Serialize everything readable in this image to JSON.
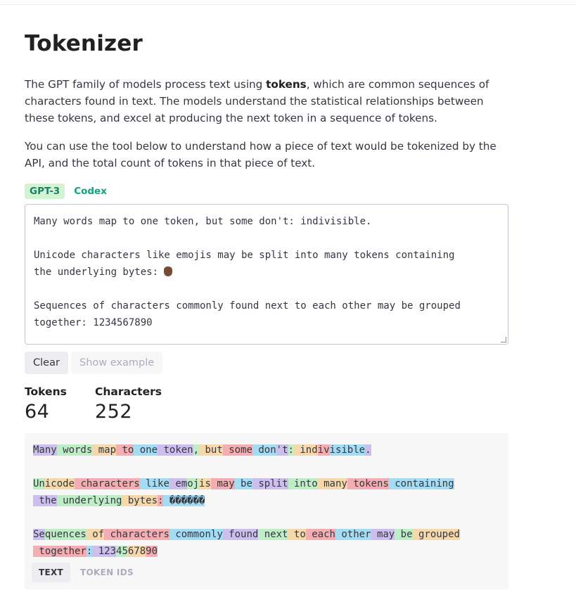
{
  "page": {
    "title": "Tokenizer",
    "intro_before": "The GPT family of models process text using ",
    "intro_bold": "tokens",
    "intro_after": ", which are common sequences of characters found in text. The models understand the statistical relationships between these tokens, and excel at producing the next token in a sequence of tokens.",
    "intro2": "You can use the tool below to understand how a piece of text would be tokenized by the API, and the total count of tokens in that piece of text."
  },
  "model_tabs": [
    {
      "label": "GPT-3",
      "active": true
    },
    {
      "label": "Codex",
      "active": false
    }
  ],
  "input": {
    "line1": "Many words map to one token, but some don't: indivisible.",
    "line2": "Unicode characters like emojis may be split into many tokens containing",
    "line3": "the underlying bytes: ",
    "emoji": "raised-hand-medium-dark-skin-tone",
    "line4": "Sequences of characters commonly found next to each other may be grouped",
    "line5": "together: 1234567890"
  },
  "buttons": {
    "clear": "Clear",
    "show_example": "Show example"
  },
  "stats": {
    "tokens_label": "Tokens",
    "tokens_value": "64",
    "characters_label": "Characters",
    "characters_value": "252"
  },
  "tokenized": {
    "lines": [
      [
        "Many",
        " words",
        " map",
        " to",
        " one",
        " token",
        ",",
        " but",
        " some",
        " don",
        "'t",
        ":",
        " ind",
        "iv",
        "isible",
        "."
      ],
      [],
      [
        "Un",
        "icode",
        " characters",
        " like",
        " em",
        "oj",
        "is",
        " may",
        " be",
        " split",
        " into",
        " many",
        " tokens",
        " containing"
      ],
      [
        "\n the",
        " underlying",
        " bytes",
        ":",
        " ������"
      ],
      [],
      [
        "Se",
        "quences",
        " of",
        " characters",
        " commonly",
        " found",
        " next",
        " to",
        " each",
        " other",
        " may",
        " be",
        " grouped"
      ],
      [
        "\n together",
        ":",
        " 123",
        "45",
        "678",
        "90"
      ]
    ]
  },
  "view_tabs": [
    {
      "label": "TEXT",
      "active": true
    },
    {
      "label": "TOKEN IDS",
      "active": false
    }
  ]
}
